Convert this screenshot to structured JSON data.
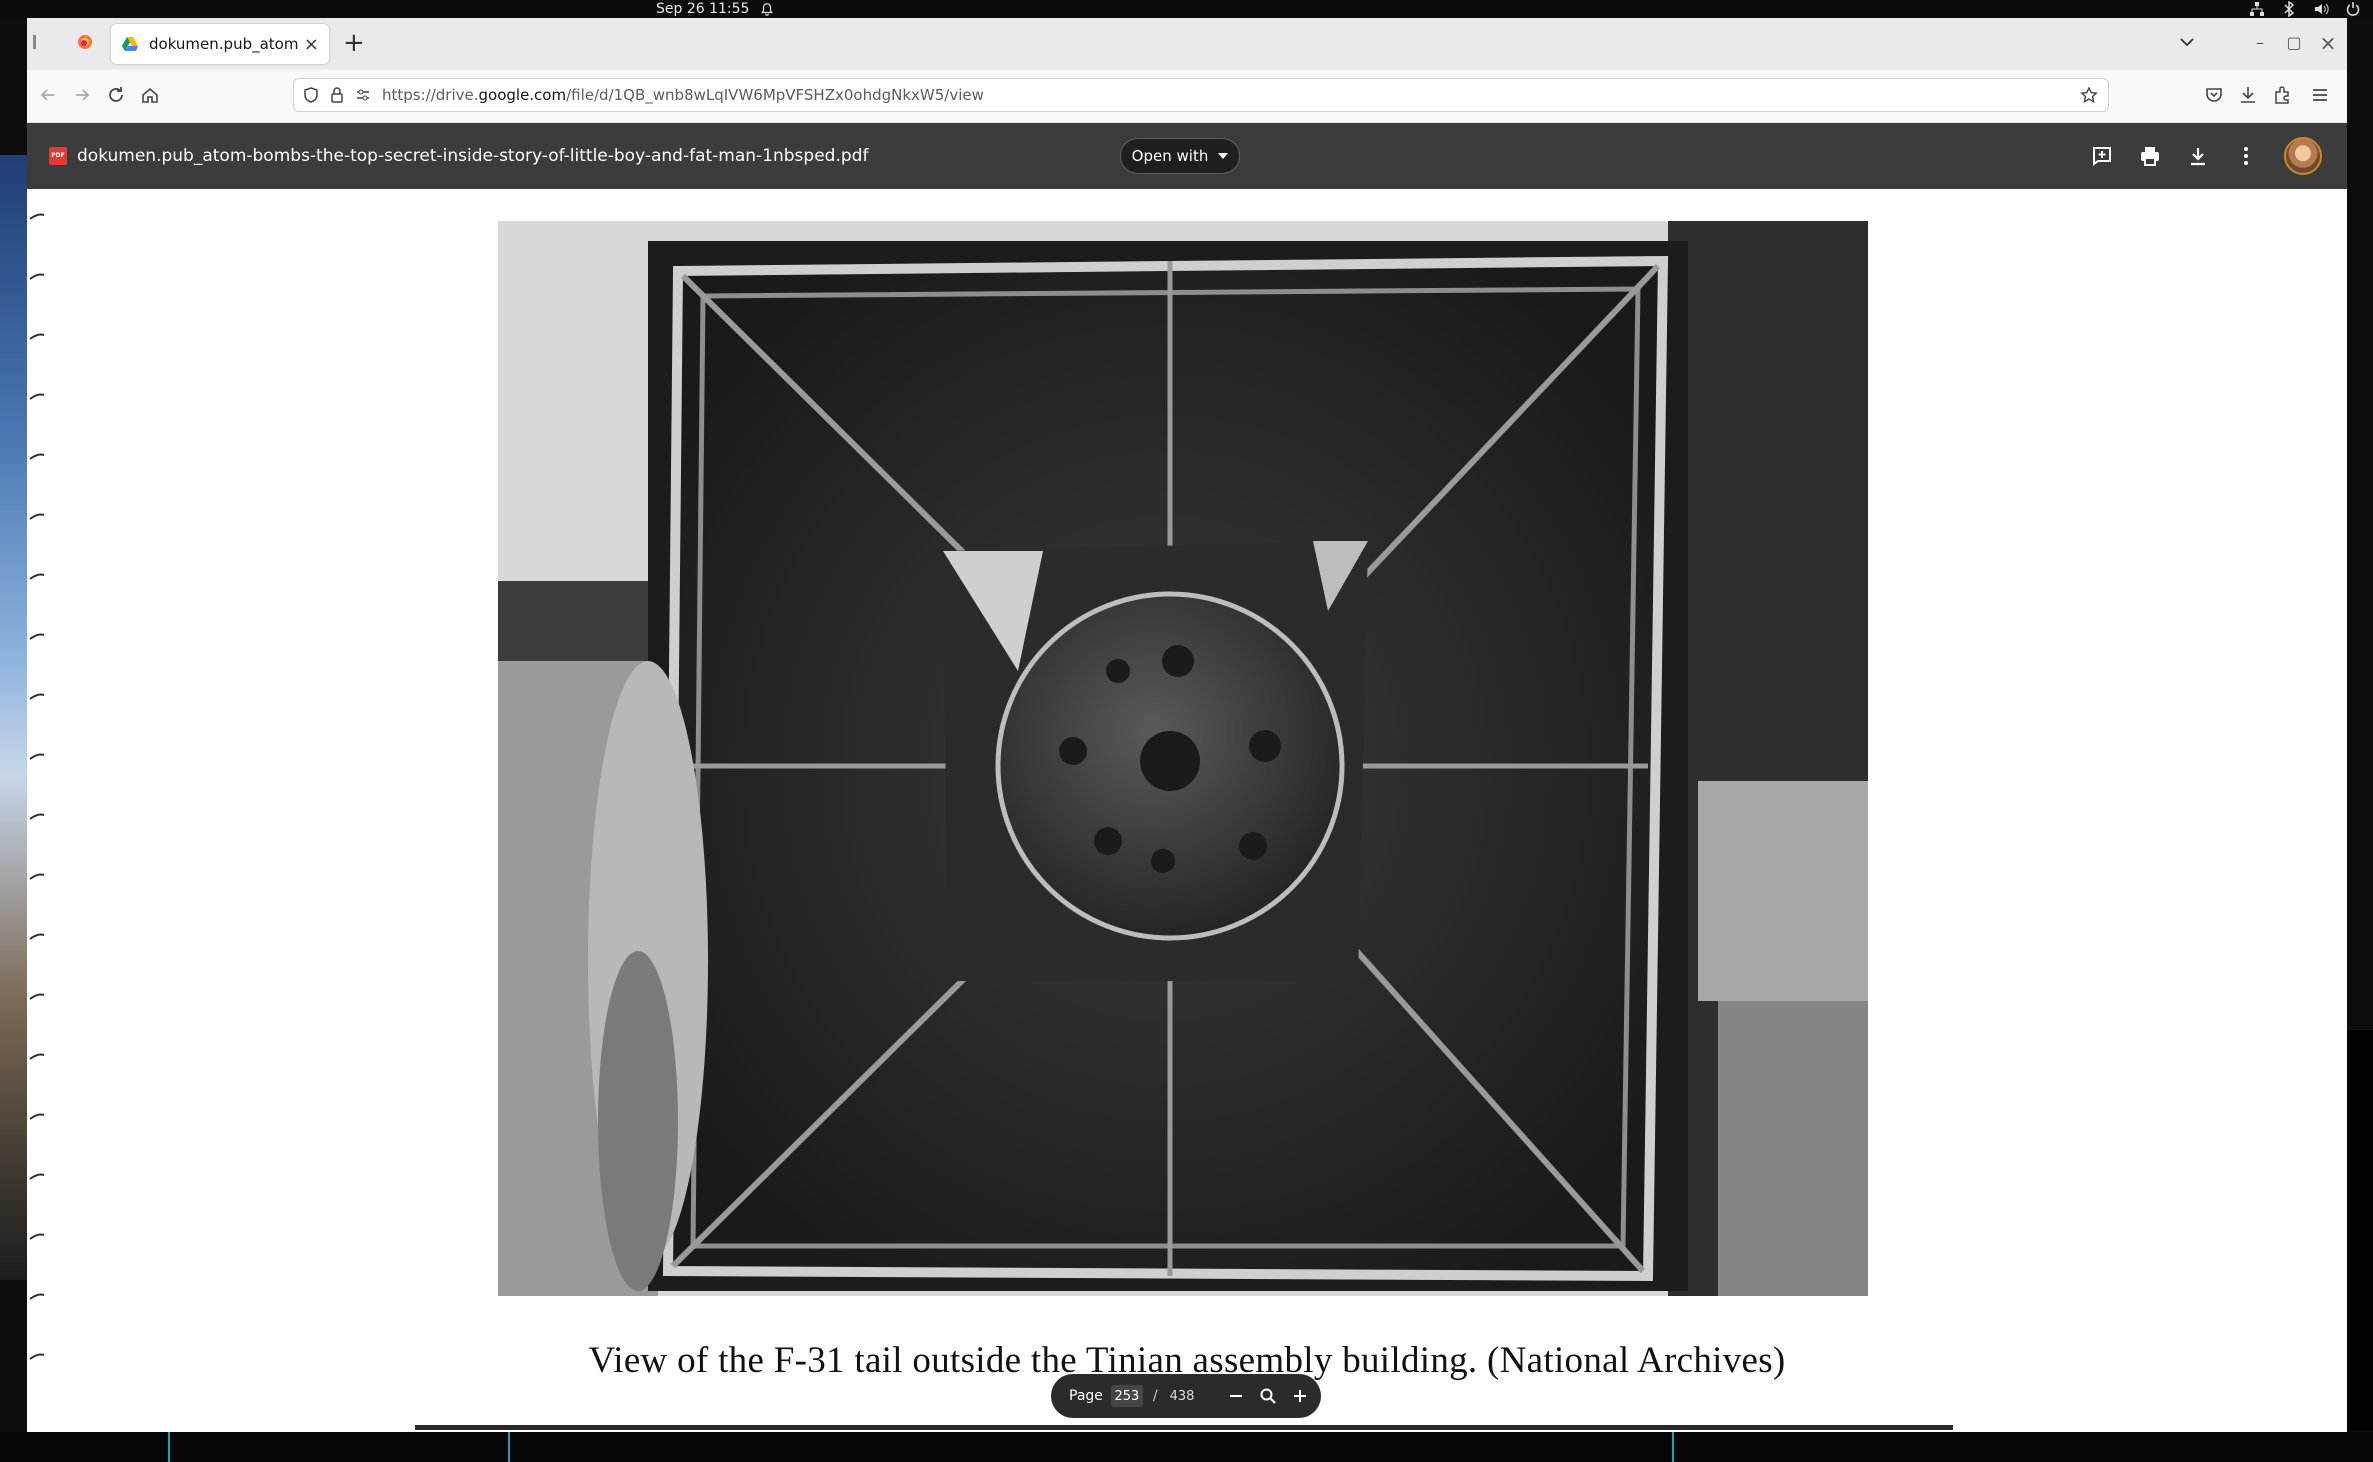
{
  "os": {
    "clock": "Sep 26  11:55"
  },
  "browser": {
    "tab_title": "dokumen.pub_atom-bom",
    "url_prefix": "https://drive.",
    "url_domain": "google.com",
    "url_path": "/file/d/1QB_wnb8wLqIVW6MpVFSHZx0ohdgNkxW5/view"
  },
  "viewer": {
    "file_name": "dokumen.pub_atom-bombs-the-top-secret-inside-story-of-little-boy-and-fat-man-1nbsped.pdf",
    "open_with_label": "Open with",
    "pdf_badge": "PDF"
  },
  "page": {
    "caption": "View of the F-31 tail outside the Tinian assembly building.  (National Archives)"
  },
  "pager": {
    "label": "Page",
    "current": "253",
    "separator": "/",
    "total": "438"
  },
  "colors": {
    "viewer_toolbar": "#3c3c3c",
    "pdf_red": "#e53935",
    "pill_bg": "#2b2b2b"
  }
}
